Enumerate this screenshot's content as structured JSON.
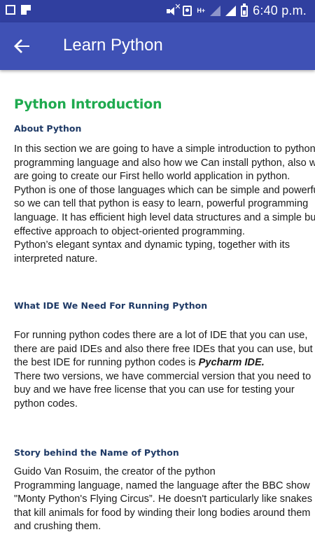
{
  "status_bar": {
    "time": "6:40 p.m.",
    "network_label": "H+",
    "icons": [
      "square-icon",
      "flipboard-icon",
      "mute-icon",
      "phone-icon",
      "signal-icon",
      "battery-icon"
    ]
  },
  "app_bar": {
    "title": "Learn Python",
    "back_icon": "arrow-back-icon",
    "background": "#3f51b5"
  },
  "content": {
    "section_title": "Python Introduction",
    "sections": [
      {
        "heading": "About Python",
        "lines": [
          "In this section we are going to have a simple introduction to python",
          "programming language and also how we Can install python, also w",
          "are going to create our First hello world application in python.",
          "Python is one of those languages which can be simple and powerfu",
          "so we can tell that python is easy to learn, powerful programming",
          "language. It has efficient high level data structures and a simple bu",
          "effective approach to object-oriented programming.",
          "Python’s elegant syntax and dynamic typing, together with its",
          "interpreted nature."
        ]
      },
      {
        "heading": "What IDE We Need For Running Python",
        "lines": [
          "For running python codes there are a lot of IDE that you can use,",
          "there are paid IDEs and also there free IDEs that you can use, but",
          "the best IDE for running python codes is",
          "There two versions, we have commercial version that you need to",
          "buy and we have free license that you can use for testing your",
          "python codes."
        ],
        "emphasis": "Pycharm IDE."
      },
      {
        "heading": "Story behind the Name of Python",
        "lines": [
          "Guido Van Rosuim, the creator of the python",
          "Programming language, named the language after the BBC show",
          "\"Monty Python's Flying Circus”. He doesn't particularly like snakes",
          "that kill animals for food by winding their long bodies around them",
          "and crushing them."
        ]
      }
    ]
  },
  "colors": {
    "status_bar": "#303f9f",
    "app_bar": "#3f51b5",
    "section_title": "#1faa4f",
    "subheading": "#1f3a66",
    "body_text": "#1a1a1a"
  }
}
